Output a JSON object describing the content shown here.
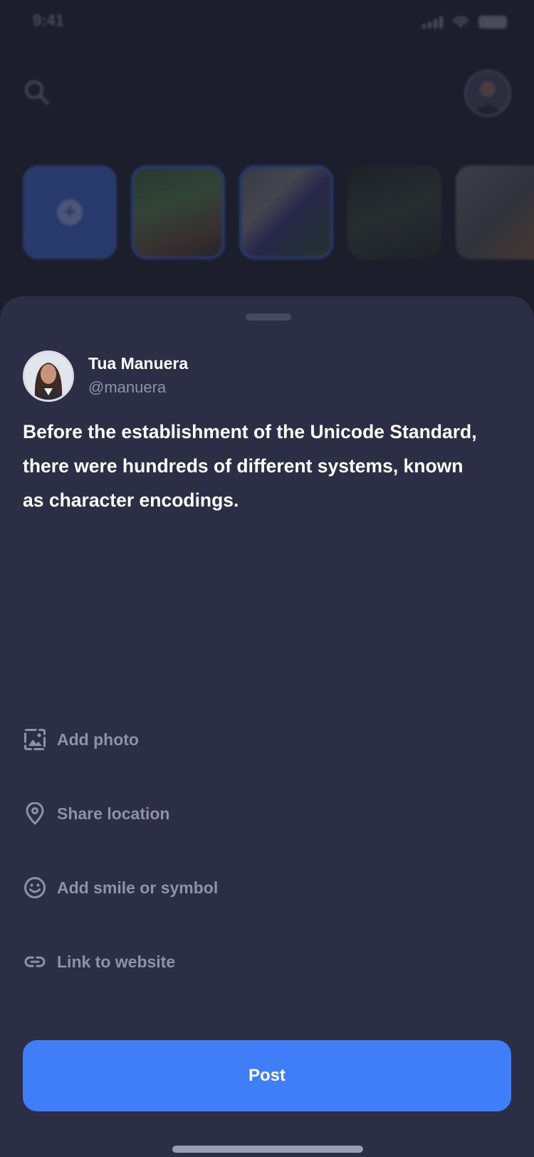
{
  "status_bar": {
    "time": "9:41"
  },
  "stories": [
    {
      "kind": "add",
      "icon": "plus-icon"
    },
    {
      "kind": "image",
      "ringed": true
    },
    {
      "kind": "image",
      "ringed": true
    },
    {
      "kind": "image",
      "ringed": false
    },
    {
      "kind": "image",
      "ringed": false
    }
  ],
  "composer": {
    "author_name": "Tua Manuera",
    "author_handle": "@manuera",
    "post_text": "Before the establishment of the Unicode Standard, there were hundreds of different systems, known as character encodings."
  },
  "actions": [
    {
      "icon": "image-icon",
      "label": "Add photo"
    },
    {
      "icon": "location-pin-icon",
      "label": "Share location"
    },
    {
      "icon": "smiley-icon",
      "label": "Add smile or symbol"
    },
    {
      "icon": "link-icon",
      "label": "Link to website"
    }
  ],
  "post_button": {
    "label": "Post"
  },
  "colors": {
    "accent": "#3f7ef8",
    "sheet_background": "#2b2e45",
    "muted_text": "#8e92a8",
    "page_background": "#1c1e2c"
  }
}
